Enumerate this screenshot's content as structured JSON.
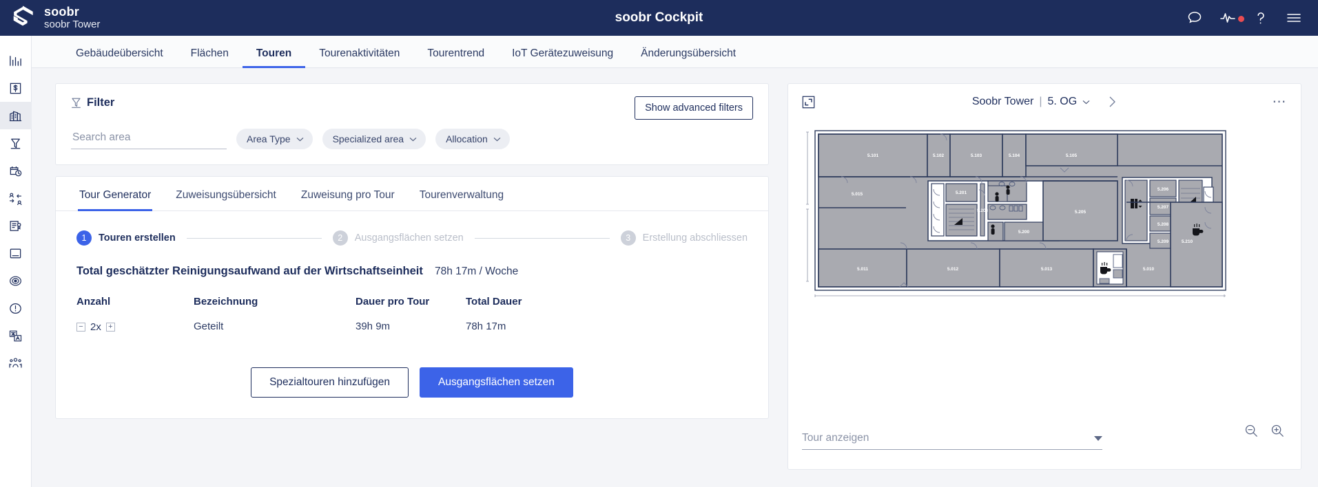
{
  "header": {
    "brand_name": "soobr",
    "brand_subtitle": "soobr Tower",
    "app_title": "soobr Cockpit",
    "icons": [
      {
        "name": "chat-bubble-icon"
      },
      {
        "name": "activity-pulse-icon",
        "badge": true
      },
      {
        "name": "help-question-icon"
      },
      {
        "name": "hamburger-menu-icon"
      }
    ]
  },
  "sidebar": {
    "items": [
      {
        "icon": "bar-chart-icon",
        "name": "analytics",
        "active": false
      },
      {
        "icon": "dollar-document-icon",
        "name": "finance",
        "active": false
      },
      {
        "icon": "building-icon",
        "name": "buildings",
        "active": true
      },
      {
        "icon": "funnel-icon",
        "name": "filters",
        "active": false
      },
      {
        "icon": "calendar-clock-icon",
        "name": "schedule",
        "active": false
      },
      {
        "icon": "user-swap-icon",
        "name": "assignments",
        "active": false
      },
      {
        "icon": "document-contract-icon",
        "name": "contracts",
        "active": false
      },
      {
        "icon": "window-card-icon",
        "name": "cards",
        "active": false
      },
      {
        "icon": "target-radar-icon",
        "name": "tracking",
        "active": false
      },
      {
        "icon": "alert-circle-icon",
        "name": "alerts",
        "active": false
      },
      {
        "icon": "translate-icon",
        "name": "language",
        "active": false
      },
      {
        "icon": "team-group-icon",
        "name": "teams",
        "active": false
      }
    ]
  },
  "nav": {
    "tabs": [
      {
        "label": "Gebäudeübersicht",
        "active": false
      },
      {
        "label": "Flächen",
        "active": false
      },
      {
        "label": "Touren",
        "active": true
      },
      {
        "label": "Tourenaktivitäten",
        "active": false
      },
      {
        "label": "Tourentrend",
        "active": false
      },
      {
        "label": "IoT Gerätezuweisung",
        "active": false
      },
      {
        "label": "Änderungsübersicht",
        "active": false
      }
    ]
  },
  "filter": {
    "title": "Filter",
    "advanced_button": "Show advanced filters",
    "search_placeholder": "Search area",
    "search_value": "",
    "chips": [
      {
        "label": "Area Type"
      },
      {
        "label": "Specialized area"
      },
      {
        "label": "Allocation"
      }
    ]
  },
  "tour_panel": {
    "tabs": [
      {
        "label": "Tour Generator",
        "active": true
      },
      {
        "label": "Zuweisungsübersicht",
        "active": false
      },
      {
        "label": "Zuweisung pro Tour",
        "active": false
      },
      {
        "label": "Tourenverwaltung",
        "active": false
      }
    ],
    "steps": [
      {
        "number": "1",
        "label": "Touren erstellen",
        "active": true
      },
      {
        "number": "2",
        "label": "Ausgangsflächen setzen",
        "active": false
      },
      {
        "number": "3",
        "label": "Erstellung abschliessen",
        "active": false
      }
    ],
    "summary": {
      "label": "Total geschätzter Reinigungsaufwand auf der Wirtschaftseinheit",
      "value": "78h 17m / Woche"
    },
    "table": {
      "columns": [
        "Anzahl",
        "Bezeichnung",
        "Dauer pro Tour",
        "Total Dauer"
      ],
      "rows": [
        {
          "anzahl": "2x",
          "decrement": "−",
          "increment": "+",
          "bezeichnung": "Geteilt",
          "dauer_pro_tour": "39h 9m",
          "total_dauer": "78h 17m"
        }
      ]
    },
    "buttons": {
      "secondary": "Spezialtouren hinzufügen",
      "primary": "Ausgangsflächen setzen"
    }
  },
  "map_panel": {
    "expand_icon": "expand-corner-icon",
    "building": "Soobr Tower",
    "separator": "|",
    "floor": "5. OG",
    "next_icon": "chevron-right-icon",
    "more_icon": "more-options-icon",
    "tour_select_placeholder": "Tour anzeigen",
    "zoom_out_icon": "zoom-out-icon",
    "zoom_in_icon": "zoom-in-icon",
    "floorplan": {
      "rooms_top": [
        "5.101",
        "5.102",
        "5.103",
        "5.104",
        "5.105"
      ],
      "rooms_mid_left": [
        "5.015"
      ],
      "rooms_core": [
        "5.201",
        "5.203",
        "5.200",
        "5.205"
      ],
      "rooms_right": [
        "5.206",
        "5.207",
        "5.208",
        "5.209",
        "5.210"
      ],
      "rooms_bottom": [
        "5.011",
        "5.012",
        "5.013",
        "5.010"
      ]
    }
  },
  "colors": {
    "navy": "#1d2d5c",
    "accent_blue": "#3c63e8",
    "red_badge": "#ea4c52",
    "page_bg": "#f4f5f8",
    "floor_fill": "#a9aab0"
  }
}
